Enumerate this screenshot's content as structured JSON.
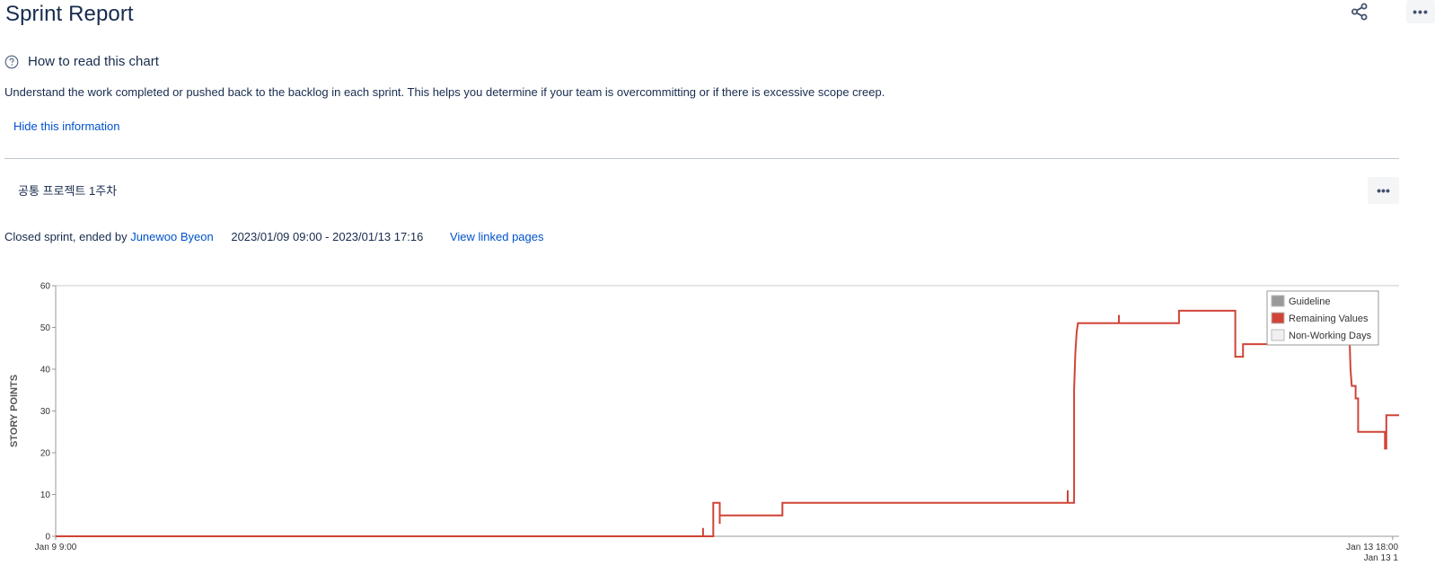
{
  "header": {
    "title": "Sprint Report",
    "share_icon": "share-icon",
    "more_label": "•••"
  },
  "help": {
    "icon": "question-circle-icon",
    "title": "How to read this chart",
    "description": "Understand the work completed or pushed back to the backlog in each sprint. This helps you determine if your team is overcommitting or if there is excessive scope creep.",
    "hide_label": "Hide this information"
  },
  "sprint": {
    "name": "공통 프로젝트 1주차",
    "more_label": "•••",
    "status_prefix": "Closed sprint, ended by ",
    "ended_by": "Junewoo Byeon",
    "dates": "2023/01/09 09:00 - 2023/01/13 17:16",
    "view_linked": "View linked pages"
  },
  "colors": {
    "remaining": "#d04437",
    "guideline": "#999999",
    "non_working": "#f0f0f0",
    "link": "#0052cc"
  },
  "chart_data": {
    "type": "line",
    "ylabel": "STORY POINTS",
    "ylim": [
      0,
      60
    ],
    "y_ticks": [
      "0",
      "10",
      "20",
      "30",
      "40",
      "50",
      "60"
    ],
    "x_ticks": [
      "Jan 9 9:00",
      "Jan 13 18:00"
    ],
    "x_tick_extra": "Jan 13 1",
    "legend_position": "top-right",
    "legend": [
      {
        "name": "Guideline",
        "color": "#999999"
      },
      {
        "name": "Remaining Values",
        "color": "#d04437"
      },
      {
        "name": "Non-Working Days",
        "color": "#f0f0f0"
      }
    ],
    "series": [
      {
        "name": "Remaining Values",
        "x_unit": "hours since Jan 9 9:00",
        "points": [
          [
            0,
            0
          ],
          [
            50.6,
            0
          ],
          [
            50.6,
            2
          ],
          [
            50.6,
            0
          ],
          [
            51.4,
            0
          ],
          [
            51.4,
            8
          ],
          [
            51.9,
            8
          ],
          [
            51.9,
            3
          ],
          [
            51.9,
            5
          ],
          [
            56.8,
            5
          ],
          [
            56.8,
            8
          ],
          [
            79.1,
            8
          ],
          [
            79.1,
            11
          ],
          [
            79.1,
            8
          ],
          [
            79.6,
            8
          ],
          [
            79.6,
            35
          ],
          [
            79.7,
            44
          ],
          [
            79.8,
            49
          ],
          [
            79.9,
            51
          ],
          [
            83.1,
            51
          ],
          [
            83.1,
            53
          ],
          [
            83.1,
            51
          ],
          [
            87.8,
            51
          ],
          [
            87.8,
            54
          ],
          [
            92.2,
            54
          ],
          [
            92.2,
            43
          ],
          [
            92.8,
            43
          ],
          [
            92.8,
            46
          ],
          [
            99.0,
            46
          ],
          [
            101.1,
            46
          ],
          [
            101.1,
            51
          ],
          [
            101.2,
            40
          ],
          [
            101.3,
            36
          ],
          [
            101.6,
            36
          ],
          [
            101.6,
            33
          ],
          [
            101.8,
            33
          ],
          [
            101.8,
            25
          ],
          [
            103.9,
            25
          ],
          [
            103.9,
            21
          ],
          [
            104.0,
            21
          ],
          [
            104.0,
            29
          ],
          [
            105.0,
            29
          ]
        ]
      }
    ]
  }
}
